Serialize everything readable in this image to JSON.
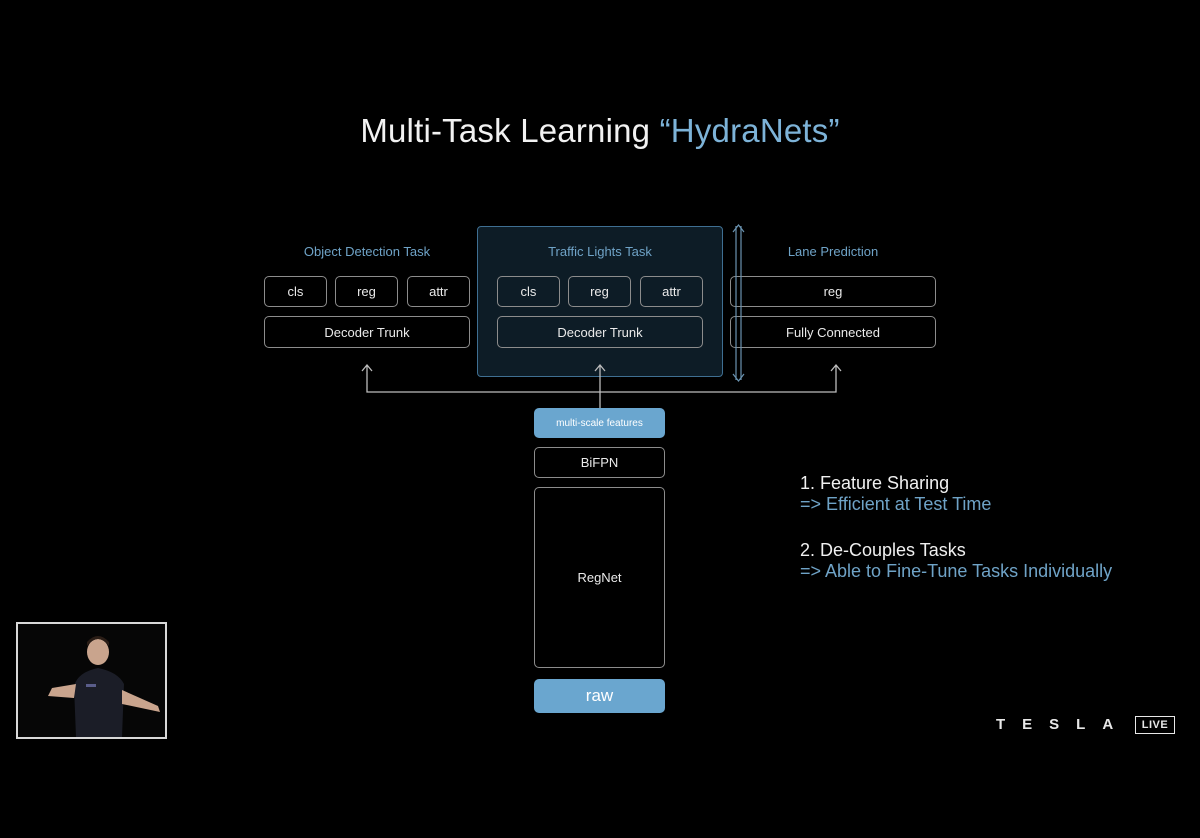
{
  "title": {
    "main": "Multi-Task Learning ",
    "highlight": "“HydraNets”"
  },
  "tasks": {
    "object_detection": {
      "label": "Object Detection Task",
      "heads": [
        "cls",
        "reg",
        "attr"
      ],
      "trunk": "Decoder Trunk"
    },
    "traffic_lights": {
      "label": "Traffic Lights Task",
      "heads": [
        "cls",
        "reg",
        "attr"
      ],
      "trunk": "Decoder Trunk"
    },
    "lane_prediction": {
      "label": "Lane Prediction",
      "head": "reg",
      "trunk": "Fully Connected"
    }
  },
  "backbone": {
    "features": "multi-scale features",
    "bifpn": "BiFPN",
    "regnet": "RegNet",
    "input": "raw"
  },
  "notes": [
    {
      "main": "1. Feature Sharing",
      "sub": "=> Efficient at Test Time"
    },
    {
      "main": "2. De-Couples Tasks",
      "sub": "=> Able to Fine-Tune Tasks Individually"
    }
  ],
  "branding": {
    "logo": "TESLA",
    "live": "LIVE"
  },
  "colors": {
    "accent": "#6aa6cf",
    "panel": "#0d1c26",
    "background": "#000000"
  }
}
